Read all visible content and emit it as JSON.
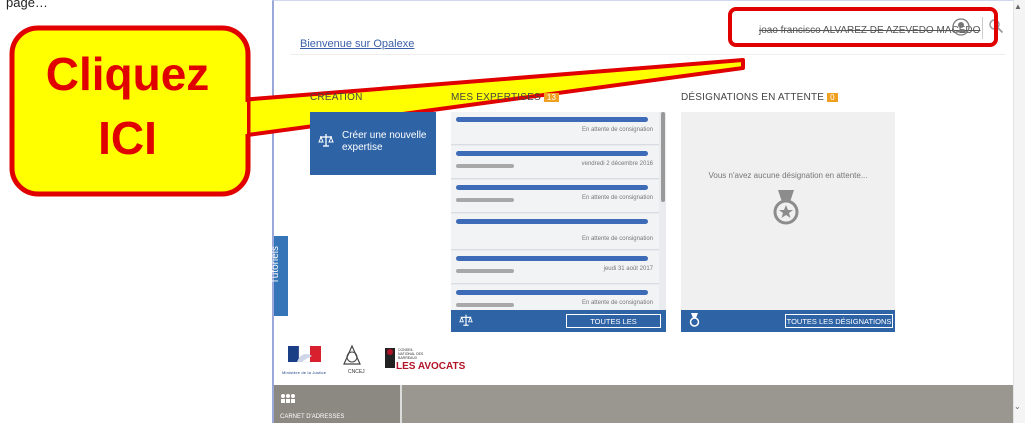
{
  "caption": "page…",
  "header": {
    "welcome": "Bienvenue sur Opalexe",
    "username": "joao francisco ALVAREZ DE AZEVEDO MACEDO"
  },
  "callout": {
    "label_line1": "Cliquez",
    "label_line2": "ICI"
  },
  "creation": {
    "title": "CRÉATION",
    "button_label": "Créer une nouvelle expertise"
  },
  "expertises": {
    "title": "MES EXPERTISES",
    "count": "13",
    "items": [
      {
        "status": "En attente de consignation"
      },
      {
        "status": "vendredi 2 décembre 2016"
      },
      {
        "status": "En attente de consignation"
      },
      {
        "status": "En attente de consignation"
      },
      {
        "status": "jeudi 31 août 2017"
      },
      {
        "status": "En attente de consignation"
      }
    ],
    "all_button": "TOUTES LES EXPERTISES"
  },
  "designations": {
    "title": "DÉSIGNATIONS EN ATTENTE",
    "count": "0",
    "empty_message": "Vous n'avez aucune désignation en attente...",
    "all_button": "TOUTES LES DÉSIGNATIONS"
  },
  "sidebar": {
    "tutorials": "Tutoriels"
  },
  "logos": {
    "ministere": "Ministère de la Justice",
    "cnb": "CNCEJ",
    "avocats_top": "CONSEIL NATIONAL DES BARREAUX",
    "avocats": "LES AVOCATS"
  },
  "bottom": {
    "carnet": "CARNET D'ADRESSES"
  },
  "colors": {
    "accent": "#2e63a6",
    "badge": "#f0a020",
    "highlight": "#e00000",
    "callout_fill": "#ffff00"
  }
}
